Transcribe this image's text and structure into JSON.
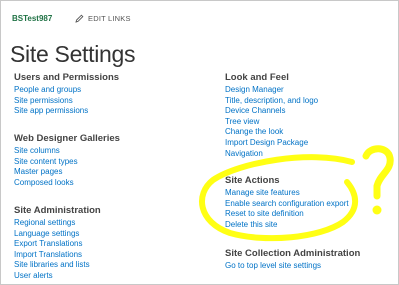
{
  "header": {
    "site_name": "BSTest987",
    "edit_links": "EDIT LINKS",
    "title": "Site Settings"
  },
  "sections": {
    "users": {
      "heading": "Users and Permissions",
      "links": [
        "People and groups",
        "Site permissions",
        "Site app permissions"
      ]
    },
    "web_designer": {
      "heading": "Web Designer Galleries",
      "links": [
        "Site columns",
        "Site content types",
        "Master pages",
        "Composed looks"
      ]
    },
    "admin": {
      "heading": "Site Administration",
      "links": [
        "Regional settings",
        "Language settings",
        "Export Translations",
        "Import Translations",
        "Site libraries and lists",
        "User alerts"
      ]
    },
    "look_feel": {
      "heading": "Look and Feel",
      "links": [
        "Design Manager",
        "Title, description, and logo",
        "Device Channels",
        "Tree view",
        "Change the look",
        "Import Design Package",
        "Navigation"
      ]
    },
    "site_actions": {
      "heading": "Site Actions",
      "links": [
        "Manage site features",
        "Enable search configuration export",
        "Reset to site definition",
        "Delete this site"
      ]
    },
    "collection_admin": {
      "heading": "Site Collection Administration",
      "links": [
        "Go to top level site settings"
      ]
    }
  },
  "colors": {
    "link": "#0072c6",
    "site_name": "#217346",
    "highlight": "#ffff00"
  },
  "icons": {
    "edit": "pencil-icon"
  }
}
